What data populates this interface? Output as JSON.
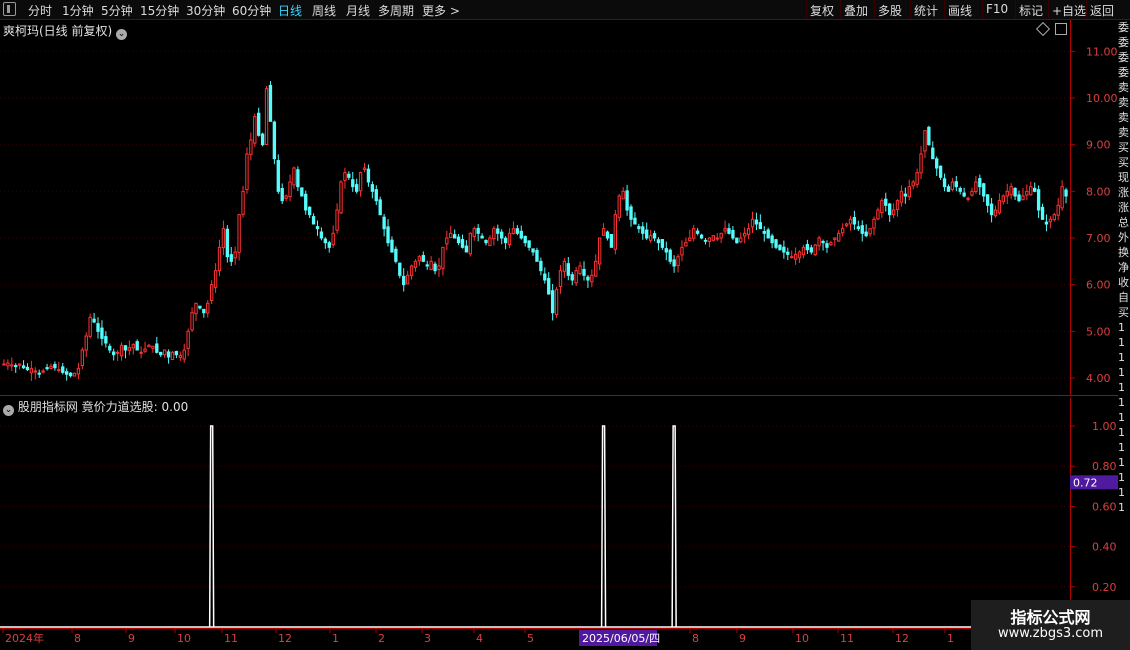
{
  "toolbar": {
    "left_items": [
      "分时",
      "1分钟",
      "5分钟",
      "15分钟",
      "30分钟",
      "60分钟",
      "日线",
      "周线",
      "月线",
      "多周期",
      "更多 >"
    ],
    "active": "日线",
    "right_items": [
      "复权",
      "叠加",
      "多股",
      "统计",
      "画线",
      "F10",
      "标记",
      "+自选",
      "返回"
    ]
  },
  "main_panel": {
    "title": "爽柯玛(日线 前复权)",
    "y_ticks": [
      "11.00",
      "10.00",
      "9.00",
      "8.00",
      "7.00",
      "6.00",
      "5.00",
      "4.00"
    ]
  },
  "indicator_panel": {
    "title": "股朋指标网 竟价力道选股: 0.00",
    "y_ticks": [
      "1.00",
      "0.80",
      "0.60",
      "0.40",
      "0.20"
    ],
    "current_label": "0.72"
  },
  "x_axis": {
    "labels": [
      "2024年",
      "8",
      "9",
      "10",
      "11",
      "12",
      "1",
      "2",
      "3",
      "4",
      "5",
      "2025/06/05/四",
      "8",
      "9",
      "10",
      "11",
      "12",
      "1"
    ]
  },
  "right_strip": {
    "chars": [
      "委",
      "委",
      "委",
      "委",
      "卖",
      "卖",
      "卖",
      "卖",
      "买",
      "买",
      "现",
      "涨",
      "涨",
      "总",
      "外",
      "换",
      "净",
      "收",
      "自",
      "买",
      "1",
      "1",
      "1",
      "1",
      "1",
      "1",
      "1",
      "1",
      "1",
      "1",
      "1",
      "1",
      "1"
    ]
  },
  "watermark": {
    "line1": "指标公式网",
    "line2": "www.zbgs3.com"
  },
  "colors": {
    "up": "#ff3232",
    "down": "#54fcfc",
    "axis": "#b00000",
    "highlight": "#4f1aa0",
    "active": "#3ad4ff"
  },
  "chart_data": {
    "type": "candlestick",
    "ylim": [
      3.7,
      11.5
    ],
    "closes": [
      4.3,
      4.32,
      4.28,
      4.25,
      4.3,
      4.22,
      4.18,
      4.2,
      4.15,
      4.1,
      4.15,
      4.2,
      4.25,
      4.22,
      4.18,
      4.12,
      4.08,
      4.05,
      4.1,
      4.2,
      4.6,
      4.9,
      5.3,
      5.2,
      5.0,
      4.85,
      4.75,
      4.6,
      4.5,
      4.55,
      4.7,
      4.6,
      4.65,
      4.72,
      4.6,
      4.55,
      4.62,
      4.7,
      4.68,
      4.55,
      4.5,
      4.6,
      4.45,
      4.55,
      4.5,
      4.48,
      4.6,
      5.0,
      5.4,
      5.6,
      5.5,
      5.4,
      5.6,
      6.0,
      6.3,
      6.8,
      7.2,
      6.6,
      6.5,
      6.7,
      7.5,
      8.0,
      8.8,
      9.1,
      9.6,
      9.2,
      9.0,
      10.2,
      9.5,
      8.7,
      8.0,
      7.8,
      7.9,
      8.2,
      8.5,
      8.1,
      7.9,
      7.6,
      7.5,
      7.3,
      7.2,
      7.0,
      6.9,
      6.8,
      7.1,
      7.6,
      8.2,
      8.4,
      8.3,
      8.1,
      8.0,
      8.4,
      8.5,
      8.2,
      8.0,
      7.8,
      7.5,
      7.2,
      6.9,
      6.7,
      6.5,
      6.2,
      6.0,
      6.2,
      6.4,
      6.5,
      6.6,
      6.5,
      6.4,
      6.5,
      6.3,
      6.4,
      6.8,
      7.0,
      7.1,
      7.0,
      6.9,
      6.8,
      6.7,
      7.1,
      7.2,
      7.1,
      7.0,
      6.9,
      7.0,
      7.2,
      7.1,
      7.0,
      6.9,
      7.1,
      7.2,
      7.1,
      7.0,
      6.9,
      6.8,
      6.7,
      6.5,
      6.3,
      6.1,
      5.8,
      5.4,
      5.9,
      6.3,
      6.5,
      6.2,
      6.1,
      6.3,
      6.4,
      6.2,
      6.1,
      6.2,
      6.5,
      7.0,
      7.2,
      7.0,
      6.8,
      7.5,
      7.9,
      8.0,
      7.6,
      7.4,
      7.3,
      7.2,
      7.1,
      7.0,
      7.05,
      7.0,
      6.9,
      6.8,
      6.7,
      6.5,
      6.4,
      6.6,
      6.8,
      6.9,
      7.0,
      7.2,
      7.1,
      7.0,
      6.95,
      7.0,
      7.05,
      7.0,
      7.1,
      7.2,
      7.1,
      7.0,
      6.9,
      7.0,
      7.1,
      7.2,
      7.4,
      7.3,
      7.2,
      7.1,
      7.0,
      6.9,
      6.8,
      6.75,
      6.7,
      6.65,
      6.6,
      6.65,
      6.7,
      6.8,
      6.75,
      6.7,
      6.85,
      7.0,
      6.9,
      6.8,
      6.9,
      7.0,
      7.1,
      7.2,
      7.3,
      7.4,
      7.3,
      7.2,
      7.1,
      7.05,
      7.2,
      7.4,
      7.6,
      7.8,
      7.7,
      7.5,
      7.6,
      7.8,
      8.0,
      7.9,
      8.1,
      8.2,
      8.4,
      8.8,
      9.3,
      9.0,
      8.7,
      8.5,
      8.3,
      8.1,
      8.0,
      8.2,
      8.1,
      8.0,
      7.9,
      7.85,
      8.0,
      8.2,
      8.1,
      7.9,
      7.7,
      7.5,
      7.6,
      7.8,
      7.9,
      8.0,
      8.1,
      7.9,
      7.8,
      7.9,
      8.0,
      8.1,
      8.0,
      7.6,
      7.4,
      7.3,
      7.4,
      7.5,
      7.7,
      8.1,
      7.9
    ]
  },
  "signal_data": {
    "type": "spike",
    "spike_days": [
      53,
      153,
      171
    ],
    "ylim": [
      0,
      1.05
    ]
  }
}
